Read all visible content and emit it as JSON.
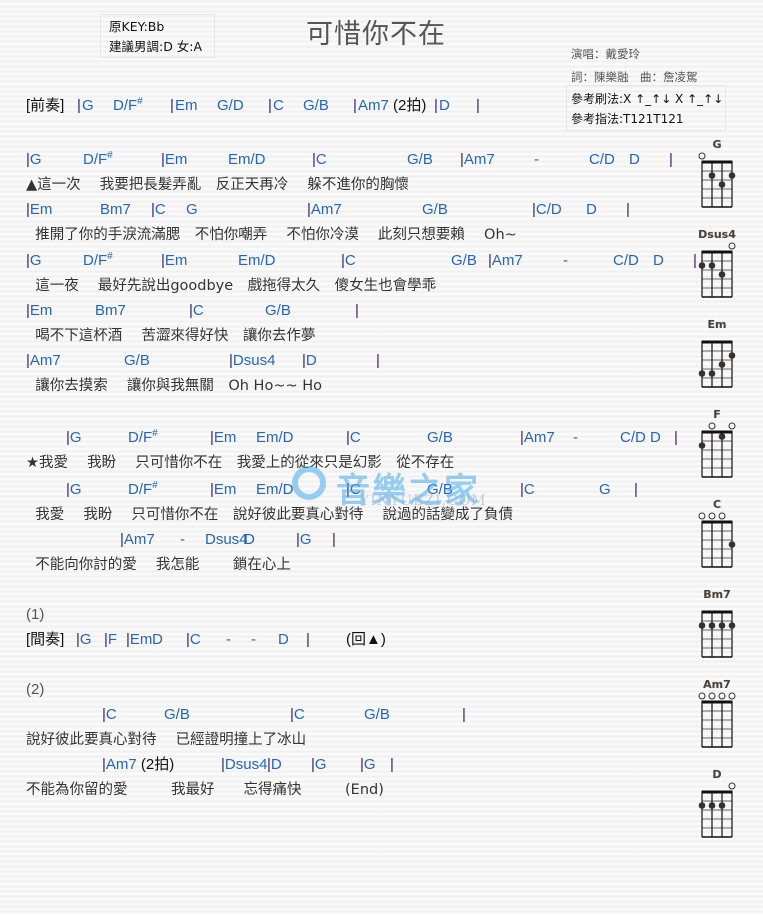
{
  "header": {
    "key_original": "原KEY:Bb",
    "key_suggested": "建議男調:D 女:A",
    "title": "可惜你不在",
    "singer": "演唱：戴愛玲",
    "writers": "詞：陳樂融　曲：詹凌駕",
    "strum_pattern": "參考刷法:X ↑_↑↓ X ↑_↑↓",
    "finger_pattern": "參考指法:T121T121"
  },
  "watermark": {
    "text": "音樂之家",
    "url_text": "YINYUEZI.COM"
  },
  "sheet": {
    "prelude": {
      "tag": "[前奏]",
      "chords": [
        "|",
        "G",
        "D/F#",
        "|",
        "Em",
        "G/D",
        "|",
        "C",
        "G/B",
        "|",
        "Am7 (2拍)",
        "|",
        "D",
        "|"
      ]
    },
    "lines": [
      {
        "type": "chord",
        "tokens": [
          "|G",
          "D/F#",
          "|Em",
          "Em/D",
          "|C",
          "G/B",
          "|Am7",
          "-",
          "C/D",
          "D",
          "|"
        ]
      },
      {
        "type": "lyric",
        "text": "▲這一次　 我要把長髮弄亂　反正天再冷　 躲不進你的胸懷"
      },
      {
        "type": "chord",
        "tokens": [
          "|Em",
          "Bm7",
          "|C",
          "G",
          "|Am7",
          "G/B",
          "|C/D",
          "D",
          "|"
        ]
      },
      {
        "type": "lyric",
        "text": "  推開了你的手淚流滿腮　不怕你嘲弄　 不怕你冷漠　 此刻只想要賴　 Oh~"
      },
      {
        "type": "chord",
        "tokens": [
          "|G",
          "D/F#",
          "|Em",
          "Em/D",
          "|C",
          "G/B",
          "|Am7",
          "-",
          "C/D",
          "D",
          "|"
        ]
      },
      {
        "type": "lyric",
        "text": "  這一夜　 最好先說出goodbye　戲拖得太久　傻女生也會學乖"
      },
      {
        "type": "chord",
        "tokens": [
          "|Em",
          "Bm7",
          "|C",
          "G/B",
          "|"
        ]
      },
      {
        "type": "lyric",
        "text": "  喝不下這杯酒　 苦澀來得好快　讓你去作夢"
      },
      {
        "type": "chord",
        "tokens": [
          "|Am7",
          "G/B",
          "|Dsus4",
          "|D",
          "|"
        ]
      },
      {
        "type": "lyric",
        "text": "  讓你去摸索　 讓你與我無關　Oh Ho~~ Ho"
      },
      {
        "type": "chord",
        "tokens": [
          "|G",
          "D/F#",
          "|Em",
          "Em/D",
          "|C",
          "G/B",
          "|Am7",
          "-",
          "C/D",
          "D",
          "|"
        ]
      },
      {
        "type": "lyric",
        "text": "★我愛　 我盼　 只可惜你不在　我愛上的從來只是幻影　從不存在"
      },
      {
        "type": "chord",
        "tokens": [
          "|G",
          "D/F#",
          "|Em",
          "Em/D",
          "|C",
          "G/B",
          "|C",
          "G",
          "|"
        ]
      },
      {
        "type": "lyric",
        "text": "  我愛　 我盼　 只可惜你不在　說好彼此要真心對待　 說過的話變成了負債"
      },
      {
        "type": "chord",
        "tokens": [
          "|Am7",
          "-",
          "Dsus4",
          "D",
          "|G",
          "|"
        ]
      },
      {
        "type": "lyric",
        "text": "  不能向你討的愛　 我怎能　 　鎖在心上"
      },
      {
        "type": "section",
        "text": "(1)"
      },
      {
        "type": "chord",
        "tokens": [
          "[間奏]",
          "|G",
          "|F",
          "|Em",
          "D",
          "|C",
          "-",
          "-",
          "D",
          "|",
          "(回▲)"
        ]
      },
      {
        "type": "section",
        "text": "(2)"
      },
      {
        "type": "chord",
        "tokens": [
          "|C",
          "G/B",
          "|C",
          "G/B",
          "|"
        ]
      },
      {
        "type": "lyric",
        "text": "說好彼此要真心對待　 已經證明撞上了冰山"
      },
      {
        "type": "chord",
        "tokens": [
          "|Am7 (2拍)",
          "|Dsus4",
          "|D",
          "|G",
          "|G",
          "|"
        ]
      },
      {
        "type": "lyric",
        "text": "不能為你留的愛　　　我最好　　忘得痛快　　　(End)"
      }
    ]
  },
  "chord_diagrams": [
    {
      "name": "G",
      "open": [
        1,
        0,
        0,
        0
      ],
      "dots": [
        [
          1,
          2
        ],
        [
          2,
          3
        ],
        [
          3,
          2
        ]
      ]
    },
    {
      "name": "Dsus4",
      "open": [
        0,
        0,
        0,
        1
      ],
      "dots": [
        [
          0,
          2
        ],
        [
          1,
          2
        ],
        [
          2,
          3
        ]
      ]
    },
    {
      "name": "Em",
      "open": [
        0,
        0,
        0,
        0
      ],
      "dots": [
        [
          0,
          4
        ],
        [
          1,
          4
        ],
        [
          2,
          3
        ],
        [
          3,
          2
        ]
      ]
    },
    {
      "name": "F",
      "open": [
        0,
        1,
        0,
        1
      ],
      "dots": [
        [
          0,
          2
        ],
        [
          2,
          1
        ]
      ]
    },
    {
      "name": "C",
      "open": [
        1,
        1,
        1,
        0
      ],
      "dots": [
        [
          3,
          3
        ]
      ]
    },
    {
      "name": "Bm7",
      "open": [
        0,
        0,
        0,
        0
      ],
      "dots": [
        [
          0,
          2
        ],
        [
          1,
          2
        ],
        [
          2,
          2
        ],
        [
          3,
          2
        ]
      ]
    },
    {
      "name": "Am7",
      "open": [
        1,
        1,
        1,
        1
      ],
      "dots": []
    },
    {
      "name": "D",
      "open": [
        0,
        0,
        0,
        1
      ],
      "dots": [
        [
          0,
          2
        ],
        [
          1,
          2
        ],
        [
          2,
          2
        ]
      ]
    }
  ]
}
